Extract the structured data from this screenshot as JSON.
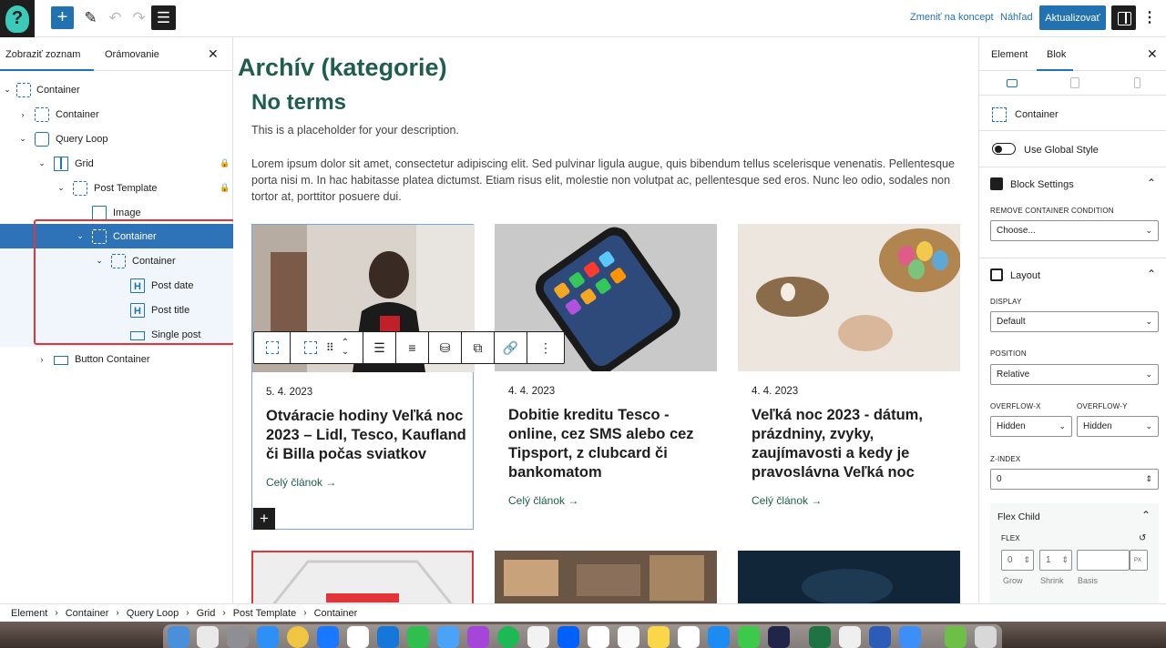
{
  "topbar": {
    "switch_draft": "Zmeniť na koncept",
    "preview": "Náhľad",
    "update": "Aktualizovať"
  },
  "left_panel": {
    "tab_list": "Zobraziť zoznam",
    "tab_outline": "Orámovanie",
    "tree": [
      {
        "label": "Container"
      },
      {
        "label": "Container"
      },
      {
        "label": "Query Loop"
      },
      {
        "label": "Grid"
      },
      {
        "label": "Post Template"
      },
      {
        "label": "Image"
      },
      {
        "label": "Container"
      },
      {
        "label": "Container"
      },
      {
        "label": "Post date"
      },
      {
        "label": "Post title"
      },
      {
        "label": "Single post"
      },
      {
        "label": "Button Container"
      }
    ]
  },
  "canvas": {
    "archive_title": "Archív (kategorie)",
    "no_terms": "No terms",
    "description": "This is a placeholder for your description.",
    "lorem": "Lorem ipsum dolor sit amet, consectetur adipiscing elit. Sed pulvinar ligula augue, quis bibendum tellus scelerisque venenatis. Pellentesque porta nisi m. In hac habitasse platea dictumst. Etiam risus elit, molestie non volutpat ac, pellentesque sed eros. Nunc leo odio, sodales non tortor at, porttitor posuere dui.",
    "posts": [
      {
        "date": "5. 4. 2023",
        "title": "Otváracie hodiny Veľká noc 2023 – Lidl, Tesco, Kaufland či Billa počas sviatkov",
        "more": "Celý článok →"
      },
      {
        "date": "4. 4. 2023",
        "title": "Dobitie kreditu Tesco - online, cez SMS alebo cez Tipsport, z clubcard či bankomatom",
        "more": "Celý článok →"
      },
      {
        "date": "4. 4. 2023",
        "title": "Veľká noc 2023 - dátum, prázdniny, zvyky, zaujímavosti a kedy je pravoslávna Veľká noc",
        "more": "Celý článok →"
      }
    ]
  },
  "right_panel": {
    "tab_element": "Element",
    "tab_block": "Blok",
    "block_name": "Container",
    "use_global_style": "Use Global Style",
    "block_settings": "Block Settings",
    "remove_condition_label": "REMOVE CONTAINER CONDITION",
    "remove_condition_value": "Choose...",
    "layout": "Layout",
    "display_label": "DISPLAY",
    "display_value": "Default",
    "position_label": "POSITION",
    "position_value": "Relative",
    "overflow_x_label": "OVERFLOW-X",
    "overflow_x_value": "Hidden",
    "overflow_y_label": "OVERFLOW-Y",
    "overflow_y_value": "Hidden",
    "zindex_label": "Z-INDEX",
    "zindex_value": "0",
    "flex_child": "Flex Child",
    "flex_label": "FLEX",
    "grow_value": "0",
    "shrink_value": "1",
    "basis_unit": "PX",
    "grow_label": "Grow",
    "shrink_label": "Shrink",
    "basis_label": "Basis"
  },
  "breadcrumb": [
    "Element",
    "Container",
    "Query Loop",
    "Grid",
    "Post Template",
    "Container"
  ],
  "colors": {
    "accent": "#2271b1",
    "heading": "#1f5d4c",
    "highlight": "#e2353a"
  }
}
